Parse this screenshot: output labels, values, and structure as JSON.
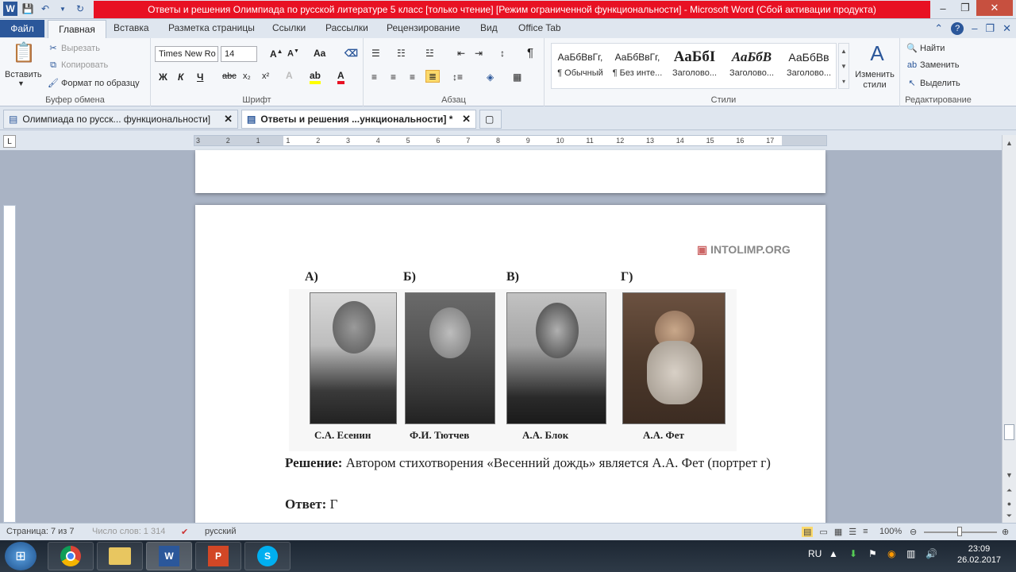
{
  "window": {
    "title": "Ответы и решения Олимпиада по русской литературе 5 класс [только чтение] [Режим ограниченной функциональности] - Microsoft Word (Сбой активации продукта)",
    "minimize": "–",
    "restore": "❐",
    "close": "✕"
  },
  "ribbon_tabs": {
    "file": "Файл",
    "home": "Главная",
    "insert": "Вставка",
    "layout": "Разметка страницы",
    "refs": "Ссылки",
    "mail": "Рассылки",
    "review": "Рецензирование",
    "view": "Вид",
    "officetab": "Office Tab"
  },
  "clipboard": {
    "paste": "Вставить",
    "cut": "Вырезать",
    "copy": "Копировать",
    "format_painter": "Формат по образцу",
    "label": "Буфер обмена"
  },
  "font": {
    "name": "Times New Ro",
    "size": "14",
    "bold": "Ж",
    "italic": "К",
    "underline": "Ч",
    "strike": "abc",
    "sub": "x₂",
    "sup": "x²",
    "aa": "Aa",
    "label": "Шрифт"
  },
  "paragraph": {
    "label": "Абзац"
  },
  "styles": {
    "items": [
      {
        "preview": "АаБбВвГг,",
        "name": "¶ Обычный"
      },
      {
        "preview": "АаБбВвГг,",
        "name": "¶ Без инте..."
      },
      {
        "preview": "АаБбI",
        "name": "Заголово..."
      },
      {
        "preview": "АаБбВ",
        "name": "Заголово..."
      },
      {
        "preview": "АаБбВв",
        "name": "Заголово..."
      }
    ],
    "change": "Изменить стили",
    "label": "Стили"
  },
  "editing": {
    "find": "Найти",
    "replace": "Заменить",
    "select": "Выделить",
    "label": "Редактирование"
  },
  "doc_tabs": {
    "tab1": "Олимпиада по русск... функциональности]",
    "tab2": "Ответы и решения ...ункциональности] *"
  },
  "ruler": {
    "ticks": [
      "3",
      "2",
      "1",
      "1",
      "2",
      "3",
      "4",
      "5",
      "6",
      "7",
      "8",
      "9",
      "10",
      "11",
      "12",
      "13",
      "14",
      "15",
      "16",
      "17"
    ]
  },
  "content": {
    "watermark": "INTOLIMP.ORG",
    "letters": [
      "А)",
      "Б)",
      "В)",
      "Г)"
    ],
    "captions": [
      "С.А. Есенин",
      "Ф.И. Тютчев",
      "А.А. Блок",
      "А.А. Фет"
    ],
    "solution_label": "Решение:",
    "solution_text": " Автором стихотворения «Весенний дождь» является А.А. Фет (портрет г)",
    "answer_label": "Ответ:",
    "answer_text": " Г"
  },
  "status": {
    "page": "Страница: 7 из 7",
    "words": "Число слов: 1 314",
    "lang": "русский",
    "zoom": "100%"
  },
  "taskbar": {
    "lang": "RU",
    "time": "23:09",
    "date": "26.02.2017"
  },
  "colors": {
    "title_red": "#e81123",
    "word_blue": "#2b579a"
  }
}
